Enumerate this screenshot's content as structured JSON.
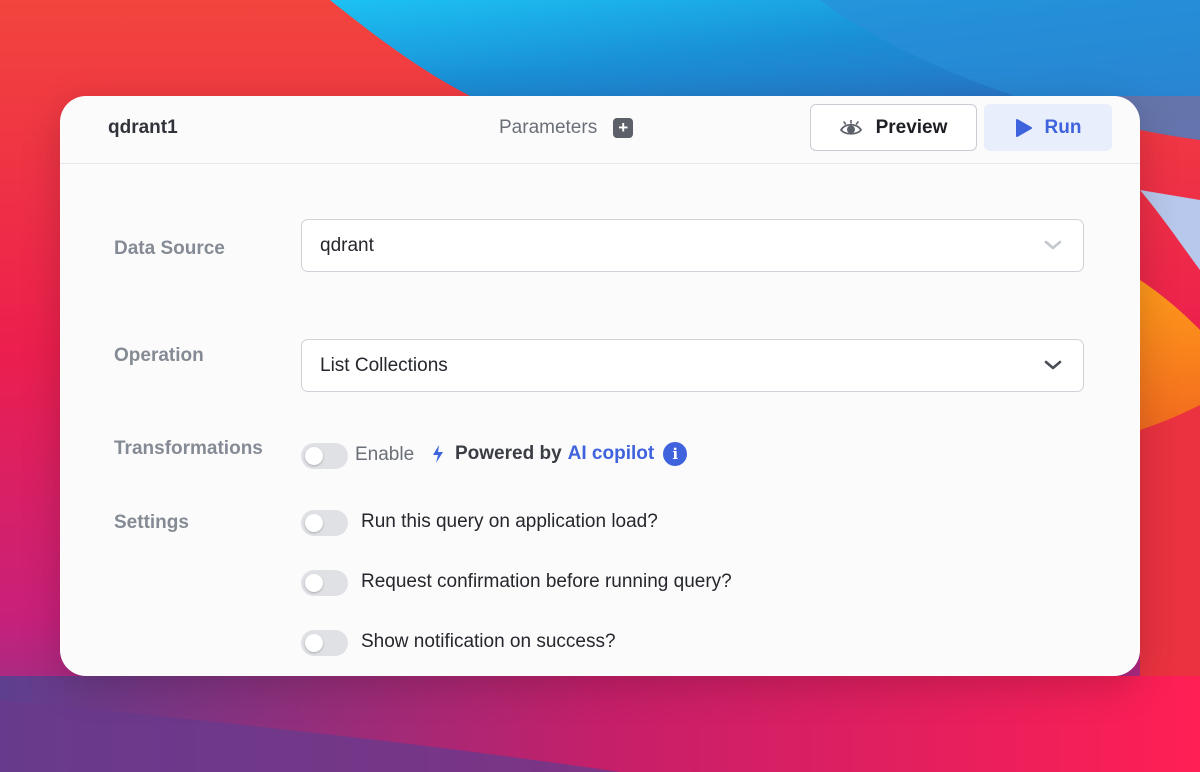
{
  "colors": {
    "accent": "#3e63dd",
    "panel_bg": "#fbfbfc",
    "label": "#858b94",
    "toggle_off": "#dfe1e5"
  },
  "header": {
    "query_name": "qdrant1",
    "parameters_label": "Parameters",
    "add_parameter_icon": "plus-square-icon",
    "preview_label": "Preview",
    "preview_icon": "eye-icon",
    "run_label": "Run",
    "run_icon": "play-icon"
  },
  "form": {
    "data_source": {
      "label": "Data Source",
      "value": "qdrant"
    },
    "operation": {
      "label": "Operation",
      "value": "List Collections"
    },
    "transformations": {
      "label": "Transformations",
      "enable_label": "Enable",
      "enabled": false,
      "powered_by": "Powered by",
      "ai_copilot": "AI copilot",
      "info_icon": "info-icon",
      "bolt_icon": "bolt-icon"
    },
    "settings": {
      "label": "Settings",
      "options": [
        {
          "label": "Run this query on application load?",
          "enabled": false
        },
        {
          "label": "Request confirmation before running query?",
          "enabled": false
        },
        {
          "label": "Show notification on success?",
          "enabled": false
        }
      ]
    }
  }
}
